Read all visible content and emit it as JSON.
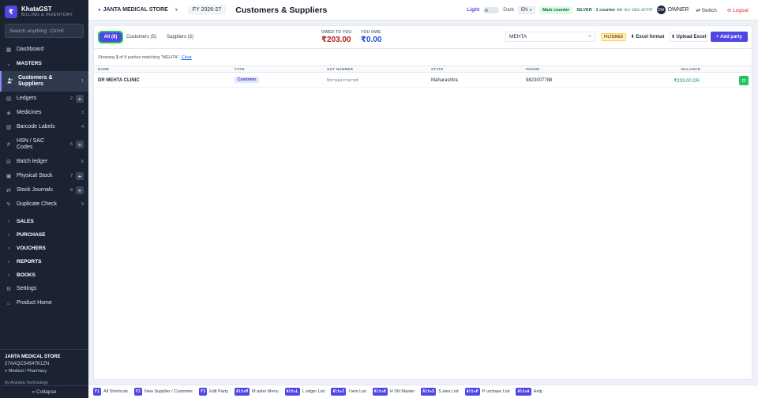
{
  "brand": {
    "name": "KhataGST",
    "subtitle": "BILLING & INVENTORY",
    "logo_glyph": "₹"
  },
  "sidebar": {
    "search_placeholder": "Search anything",
    "search_shortcut": "Ctrl+K",
    "items": [
      {
        "label": "Dashboard",
        "icon": "dashboard-icon",
        "glyph": "▦"
      },
      {
        "label": "MASTERS",
        "icon": "chevron-down-icon",
        "glyph": "⌄"
      },
      {
        "label": "Customers & Suppliers",
        "icon": "users-icon",
        "glyph": "👥",
        "count": "1"
      },
      {
        "label": "Ledgers",
        "icon": "book-icon",
        "glyph": "▤",
        "count": "2"
      },
      {
        "label": "Medicines",
        "icon": "tag-icon",
        "glyph": "◈",
        "count": "3"
      },
      {
        "label": "Barcode Labels",
        "icon": "barcode-icon",
        "glyph": "▥",
        "count": "4"
      },
      {
        "label": "HSN / SAC Codes",
        "icon": "hash-icon",
        "glyph": "#",
        "count": "5"
      },
      {
        "label": "Batch ledger",
        "icon": "batch-icon",
        "glyph": "⊟",
        "count": "6"
      },
      {
        "label": "Physical Stock",
        "icon": "box-icon",
        "glyph": "▣",
        "count": "7"
      },
      {
        "label": "Stock Journals",
        "icon": "shuffle-icon",
        "glyph": "⇄",
        "count": "8"
      },
      {
        "label": "Duplicate Check",
        "icon": "wand-icon",
        "glyph": "✎",
        "count": "9"
      },
      {
        "label": "SALES",
        "icon": "chevron-right-icon",
        "glyph": "›"
      },
      {
        "label": "PURCHASE",
        "icon": "chevron-right-icon",
        "glyph": "›"
      },
      {
        "label": "VOUCHERS",
        "icon": "chevron-right-icon",
        "glyph": "›"
      },
      {
        "label": "REPORTS",
        "icon": "chevron-right-icon",
        "glyph": "›"
      },
      {
        "label": "BOOKS",
        "icon": "chevron-right-icon",
        "glyph": "›"
      },
      {
        "label": "Settings",
        "icon": "gear-icon",
        "glyph": "⚙"
      },
      {
        "label": "Product Home",
        "icon": "home-icon",
        "glyph": "⌂"
      }
    ],
    "plus_glyph": "+",
    "footer": {
      "company": "JANTA MEDICAL STORE",
      "gstin": "27AAQCS4547K1ZN",
      "type": "Medical / Pharmacy",
      "by": "by Anedya Technology"
    },
    "collapse_label": "« Collapse"
  },
  "header": {
    "company": "JANTA MEDICAL STORE",
    "fy": "FY 2026-27",
    "title": "Customers & Suppliers",
    "theme_light": "Light",
    "theme_dark": "Dark",
    "lang": "EN",
    "counter": "Main counter",
    "license": "SILVER · 1 counter",
    "license_code": "AND-SLV-2026-4E7F97",
    "owner_initials": "OW",
    "owner": "OWNER",
    "switch": "⇄ Switch",
    "logout": "⊖ Logout"
  },
  "toolbar": {
    "tabs": [
      {
        "label": "All (8)"
      },
      {
        "label": "Customers (5)"
      },
      {
        "label": "Suppliers (3)"
      }
    ],
    "owed_to_you_label": "OWED TO YOU",
    "owed_to_you_value": "₹203.00",
    "you_owe_label": "YOU OWE",
    "you_owe_value": "₹0.00",
    "search_value": "MEHTA",
    "filtered_badge": "FILTERED",
    "excel_format": "⬇ Excel format",
    "upload_excel": "⬆ Upload Excel",
    "add_party": "+ Add party"
  },
  "list": {
    "showing_prefix": "Showing",
    "showing_count": "1",
    "showing_suffix": "of 8 parties matching \"MEHTA\".",
    "clear": "Clear",
    "columns": [
      "NAME",
      "TYPE",
      "GST NUMBER",
      "STATE",
      "PHONE",
      "BALANCE"
    ],
    "rows": [
      {
        "name": "DR MEHTA CLINIC",
        "type": "Customer",
        "gst": "Unregistered",
        "state": "Maharashtra",
        "phone": "9823007788",
        "balance": "₹203.00 DR",
        "action_glyph": "⊡"
      }
    ]
  },
  "shortcuts": [
    {
      "key": "F1",
      "label": "All Shortcuts"
    },
    {
      "key": "F2",
      "label": "New Supplier / Customer"
    },
    {
      "key": "F3",
      "label": "Edit Party"
    },
    {
      "key": "Alt+M",
      "label": "M aster Menu"
    },
    {
      "key": "Alt+L",
      "label": "L edger List"
    },
    {
      "key": "Alt+I",
      "label": "I tem List"
    },
    {
      "key": "Alt+H",
      "label": "H SN Master"
    },
    {
      "key": "Alt+S",
      "label": "S ales List"
    },
    {
      "key": "Alt+P",
      "label": "P urchase List"
    },
    {
      "key": "Alt+A",
      "label": "Help"
    }
  ],
  "colors": {
    "accent": "#4f46e5",
    "sidebar_bg": "#1b2333",
    "owed": "#b91c1c",
    "owe": "#1d4ed8",
    "balance": "#059669"
  }
}
